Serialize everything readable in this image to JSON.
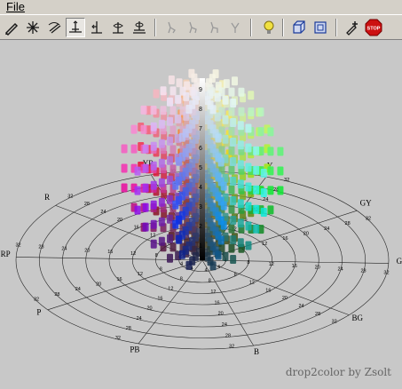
{
  "menu": {
    "file_label": "File"
  },
  "toolbar": {
    "buttons": [
      {
        "name": "pen-tool-icon",
        "color": "#1a1a1a"
      },
      {
        "name": "sparkle-tool-icon",
        "color": "#1a1a1a"
      },
      {
        "name": "rotate-tool-icon",
        "color": "#1a1a1a"
      },
      {
        "name": "axis-tool-icon",
        "color": "#1a1a1a"
      },
      {
        "name": "axis-left-icon",
        "color": "#1a1a1a"
      },
      {
        "name": "axis-rotate-icon",
        "color": "#1a1a1a"
      },
      {
        "name": "axis-flat-icon",
        "color": "#1a1a1a"
      },
      {
        "name": "walk-icon-1",
        "color": "#999999"
      },
      {
        "name": "walk-icon-2",
        "color": "#999999"
      },
      {
        "name": "walk-icon-3",
        "color": "#999999"
      },
      {
        "name": "walk-icon-4",
        "color": "#999999"
      },
      {
        "name": "lightbulb-icon",
        "color": "#e8d020"
      },
      {
        "name": "cube-icon",
        "color": "#1a3a9a"
      },
      {
        "name": "frame-icon",
        "color": "#1a3a9a"
      },
      {
        "name": "add-pen-icon",
        "color": "#1a1a1a"
      },
      {
        "name": "stop-icon",
        "color": "#cc1111"
      }
    ],
    "stop_label": "STOP"
  },
  "hue_labels": [
    "Y",
    "GY",
    "G",
    "BG",
    "B",
    "PB",
    "P",
    "RP",
    "R",
    "YR"
  ],
  "chroma_ticks": [
    "2",
    "4",
    "6",
    "8",
    "10",
    "12",
    "14",
    "16",
    "18",
    "20",
    "22",
    "24",
    "26",
    "28",
    "30",
    "32",
    "34",
    "36",
    "38"
  ],
  "value_labels": [
    "9",
    "8",
    "7",
    "6",
    "5",
    "4",
    "3",
    "2",
    "1"
  ],
  "credit": "drop2color by Zsolt"
}
